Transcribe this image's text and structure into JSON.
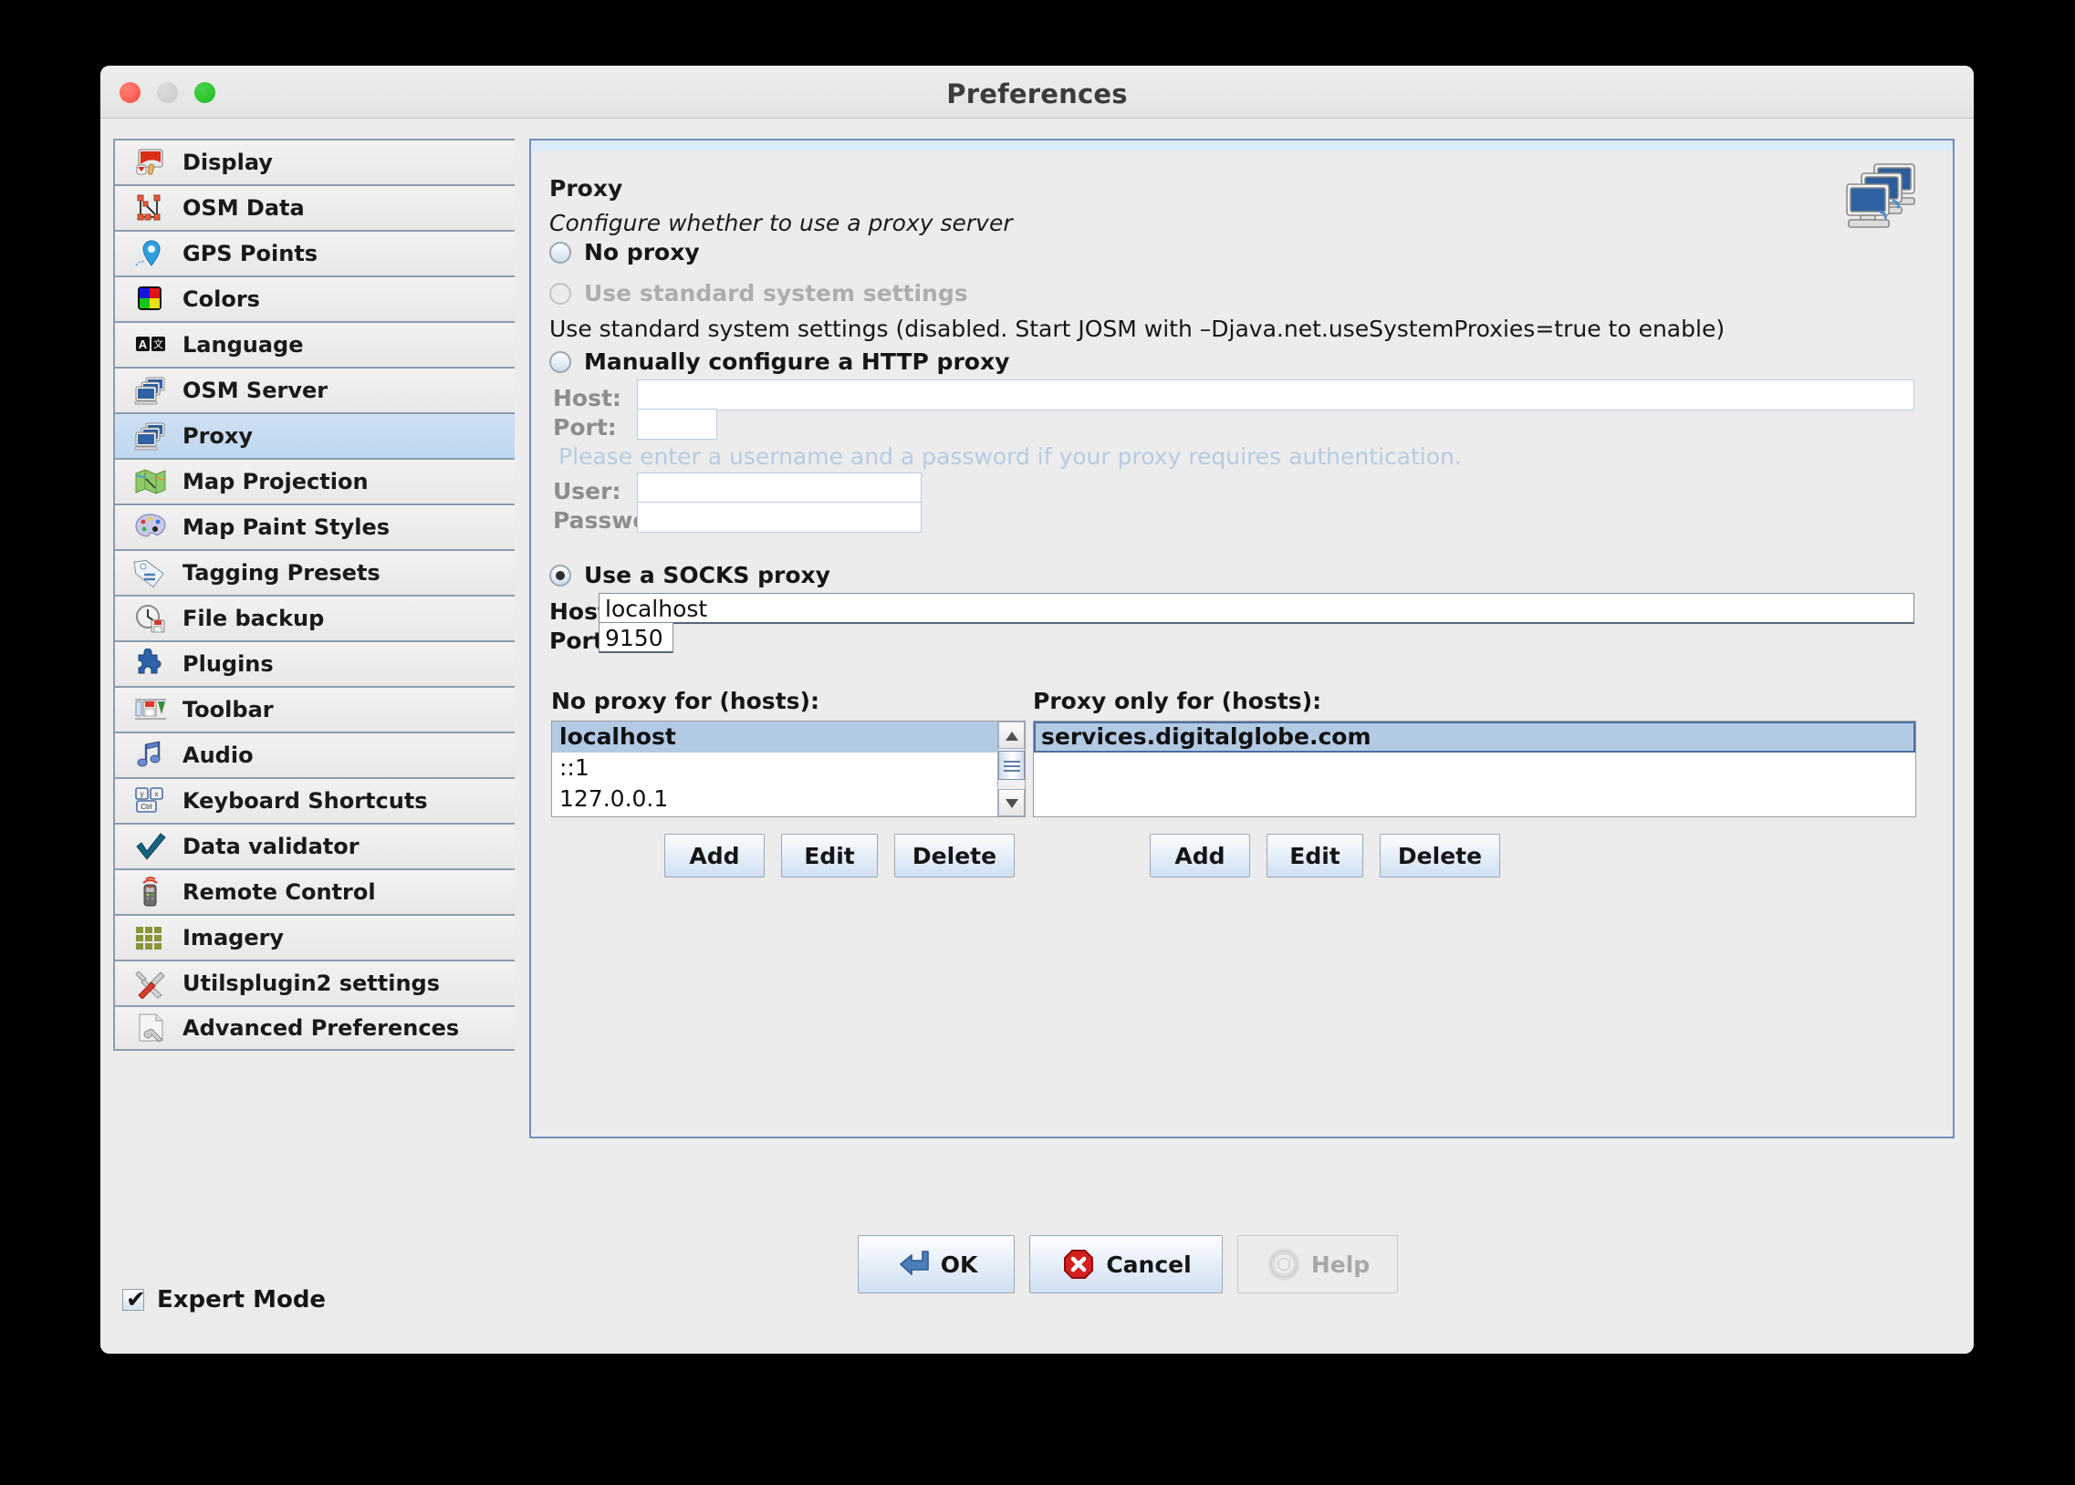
{
  "window": {
    "title": "Preferences",
    "traffic_lights": [
      "close",
      "minimize",
      "zoom"
    ]
  },
  "sidebar": {
    "items": [
      {
        "label": "Display",
        "icon": "display-icon",
        "selected": false
      },
      {
        "label": "OSM Data",
        "icon": "osm-data-icon",
        "selected": false
      },
      {
        "label": "GPS Points",
        "icon": "gps-points-icon",
        "selected": false
      },
      {
        "label": "Colors",
        "icon": "colors-icon",
        "selected": false
      },
      {
        "label": "Language",
        "icon": "language-icon",
        "selected": false
      },
      {
        "label": "OSM Server",
        "icon": "osm-server-icon",
        "selected": false
      },
      {
        "label": "Proxy",
        "icon": "proxy-icon",
        "selected": true
      },
      {
        "label": "Map Projection",
        "icon": "map-projection-icon",
        "selected": false
      },
      {
        "label": "Map Paint Styles",
        "icon": "map-paint-styles-icon",
        "selected": false
      },
      {
        "label": "Tagging Presets",
        "icon": "tagging-presets-icon",
        "selected": false
      },
      {
        "label": "File backup",
        "icon": "file-backup-icon",
        "selected": false
      },
      {
        "label": "Plugins",
        "icon": "plugins-icon",
        "selected": false
      },
      {
        "label": "Toolbar",
        "icon": "toolbar-icon",
        "selected": false
      },
      {
        "label": "Audio",
        "icon": "audio-icon",
        "selected": false
      },
      {
        "label": "Keyboard Shortcuts",
        "icon": "keyboard-shortcuts-icon",
        "selected": false
      },
      {
        "label": "Data validator",
        "icon": "data-validator-icon",
        "selected": false
      },
      {
        "label": "Remote Control",
        "icon": "remote-control-icon",
        "selected": false
      },
      {
        "label": "Imagery",
        "icon": "imagery-icon",
        "selected": false
      },
      {
        "label": "Utilsplugin2 settings",
        "icon": "utilsplugin2-icon",
        "selected": false
      },
      {
        "label": "Advanced Preferences",
        "icon": "advanced-preferences-icon",
        "selected": false
      }
    ]
  },
  "panel": {
    "title": "Proxy",
    "subtitle": "Configure whether to use a proxy server",
    "header_icon": "proxy-servers-icon",
    "options": {
      "no_proxy": {
        "label": "No proxy",
        "selected": false,
        "disabled": false
      },
      "system": {
        "label": "Use standard system settings",
        "selected": false,
        "disabled": true,
        "note": "Use standard system settings (disabled. Start JOSM with –Djava.net.useSystemProxies=true to enable)"
      },
      "http": {
        "label": "Manually configure a HTTP proxy",
        "selected": false,
        "disabled": false,
        "host_label": "Host:",
        "host_value": "",
        "port_label": "Port:",
        "port_value": "",
        "auth_hint": "Please enter a username and a password if your proxy requires authentication.",
        "user_label": "User:",
        "user_value": "",
        "password_label": "Password:",
        "password_value": ""
      },
      "socks": {
        "label": "Use a SOCKS proxy",
        "selected": true,
        "disabled": false,
        "host_label": "Host:",
        "host_value": "localhost",
        "port_label": "Port:",
        "port_value": "9150"
      }
    },
    "no_proxy_for": {
      "title": "No proxy for (hosts):",
      "items": [
        "localhost",
        "::1",
        "127.0.0.1"
      ],
      "selected_index": 0,
      "has_scrollbar": true,
      "buttons": {
        "add": "Add",
        "edit": "Edit",
        "delete": "Delete"
      }
    },
    "proxy_only_for": {
      "title": "Proxy only for (hosts):",
      "items": [
        "services.digitalglobe.com"
      ],
      "selected_index": 0,
      "has_scrollbar": false,
      "buttons": {
        "add": "Add",
        "edit": "Edit",
        "delete": "Delete"
      }
    }
  },
  "footer": {
    "expert_mode": {
      "label": "Expert Mode",
      "checked": true,
      "mark": "✔"
    },
    "ok": {
      "label": "OK",
      "icon": "enter-arrow-icon",
      "disabled": false
    },
    "cancel": {
      "label": "Cancel",
      "icon": "cancel-octagon-icon",
      "disabled": false
    },
    "help": {
      "label": "Help",
      "icon": "lifebuoy-icon",
      "disabled": true
    }
  },
  "colors": {
    "selection_blue": "#bed7ef",
    "panel_border": "#6f8fbe",
    "window_bg": "#ececec",
    "accent_red": "#d41f1f"
  }
}
